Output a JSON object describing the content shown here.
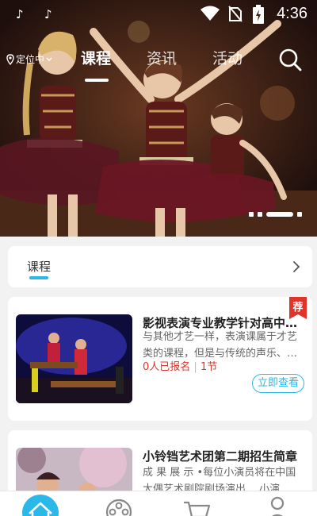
{
  "status_bar": {
    "time": "4:36",
    "icons": [
      "tiktok-icon",
      "tiktok-icon",
      "wifi-icon",
      "no-sim-icon",
      "battery-charging-icon"
    ]
  },
  "header": {
    "location": "定位中",
    "tabs": [
      {
        "label": "课程",
        "active": true
      },
      {
        "label": "资讯",
        "active": false
      },
      {
        "label": "活动",
        "active": false
      }
    ],
    "search_icon": "search-icon"
  },
  "banner": {
    "carousel_total": 4,
    "carousel_active": 3
  },
  "section": {
    "title": "课程",
    "arrow_icon": "chevron-right-icon"
  },
  "courses": [
    {
      "title": "影视表演专业教学针对高中…",
      "description": "与其他才艺一样，表演课属于才艺类的课程，但是与传统的声乐、…",
      "enrolled": "0人已报名",
      "separator": "|",
      "lessons": "1节",
      "button": "立即查看",
      "badge": "荐"
    },
    {
      "title": "小铃铛艺术团第二期招生简章",
      "description": "成 果 展 示 •每位小演员将在中国大偶艺术剧院剧场演出 …小演…"
    }
  ],
  "colors": {
    "accent": "#29b8e8",
    "highlight": "#e0342a",
    "background": "#f2f2f2"
  },
  "bottom_nav": [
    "home-icon",
    "film-reel-icon",
    "cart-icon",
    "user-icon"
  ]
}
